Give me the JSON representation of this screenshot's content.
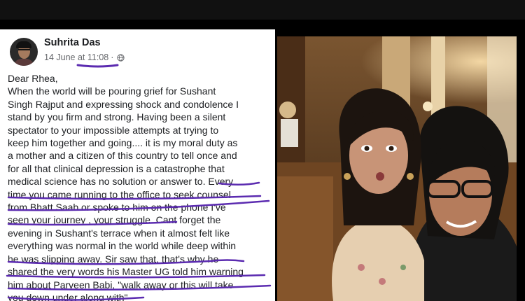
{
  "post": {
    "author": "Suhrita Das",
    "date": "14 June at",
    "time": "11:08",
    "separator": "·",
    "privacy_icon": "globe-icon",
    "lines": [
      "Dear Rhea,",
      "When the world will be pouring grief for Sushant",
      "Singh Rajput and expressing shock and condolence I",
      "stand by you firm and strong. Having been a silent",
      "spectator to your impossible attempts at trying to",
      "keep him together and going.... it is my moral duty as",
      "a mother and a citizen of this country to tell once and",
      "for all that clinical depression is a catastrophe that",
      "medical science has no solution or answer to. Every",
      "time you came running to the office to seek counsel",
      "from Bhatt Saab or spoke to him on the phone I've",
      "seen your journey , your struggle. Cant forget the",
      "evening in Sushant's terrace when it almost felt like",
      "everything was normal in the world while deep within",
      "he was slipping away. Sir saw that, that's why he",
      "shared the very words his Master UG told him warning",
      "him about Parveen Babi, \"walk away or this will take",
      "you down under along with\""
    ]
  },
  "colors": {
    "highlight": "#5b2bb0",
    "text": "#1c1e21",
    "meta": "#65676b"
  }
}
